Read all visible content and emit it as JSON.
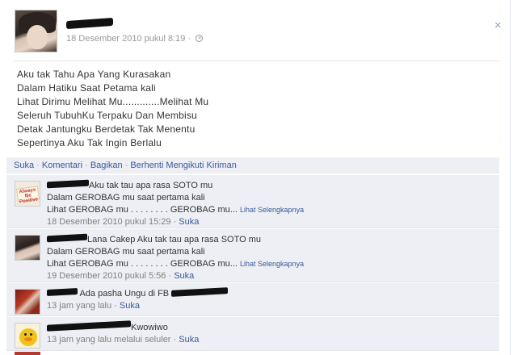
{
  "post": {
    "timestamp": "18 Desember 2010 pukul 8:19",
    "meta_separator": "·",
    "message_lines": [
      "Aku tak Tahu Apa Yang Kurasakan",
      "Dalam Hatiku Saat Petama kali",
      "Lihat Dirimu Melihat Mu.............Melihat Mu",
      "Seleruh TubuhKu Terpaku Dan Membisu",
      "Detak Jantungku Berdetak Tak Menentu",
      "Sepertinya Aku Tak Ingin Berlalu"
    ],
    "close_glyph": "×"
  },
  "actions": {
    "like": "Suka",
    "comment": "Komentari",
    "share": "Bagikan",
    "unfollow": "Berhenti Mengikuti Kiriman",
    "separator": "·"
  },
  "comments": [
    {
      "avatar": "always-positive-sign",
      "avatar_text": "Always Be Positive",
      "text_line1": "Aku tak tau apa rasa SOTO mu",
      "text_line2": "Dalam GEROBAG mu saat pertama kali",
      "text_line3": "Lihat GEROBAG mu . . . . . . . . GEROBAG mu...",
      "see_more": "Lihat Selengkapnya",
      "time": "18 Desember 2010 pukul 15:29",
      "like": "Suka"
    },
    {
      "avatar": "girl-photo",
      "text_line1": "Lana Cakep Aku tak tau apa rasa SOTO mu",
      "text_line2": "Dalam GEROBAG mu saat pertama kali",
      "text_line3": "Lihat GEROBAG mu . . . . . . . . GEROBAG mu...",
      "see_more": "Lihat Selengkapnya",
      "time": "19 Desember 2010 pukul 5:56",
      "like": "Suka"
    },
    {
      "avatar": "red-hair-anime",
      "text_line1": "Ada pasha Ungu di FB",
      "time": "13 jam yang lalu",
      "like": "Suka"
    },
    {
      "avatar": "yellow-duck",
      "text_line1": "Kwowiwo",
      "time": "13 jam yang lalu melalui seluler",
      "like": "Suka"
    }
  ],
  "colors": {
    "link": "#3b5998",
    "comment_bg": "#edeff4",
    "meta_gray": "#999999"
  }
}
